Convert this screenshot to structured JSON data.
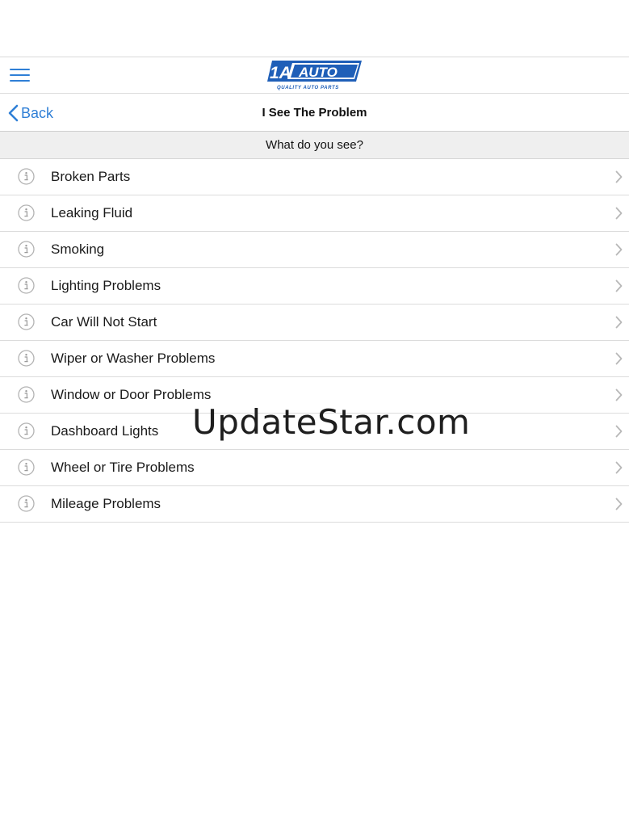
{
  "header": {
    "logo_main": "1A AUTO",
    "logo_tagline": "QUALITY AUTO PARTS",
    "menu_icon": "hamburger-menu-icon"
  },
  "navbar": {
    "back_label": "Back",
    "title": "I See The Problem"
  },
  "section": {
    "header": "What do you see?"
  },
  "items": [
    {
      "label": "Broken Parts"
    },
    {
      "label": "Leaking Fluid"
    },
    {
      "label": "Smoking"
    },
    {
      "label": "Lighting Problems"
    },
    {
      "label": "Car Will Not Start"
    },
    {
      "label": "Wiper or Washer Problems"
    },
    {
      "label": "Window or Door Problems"
    },
    {
      "label": "Dashboard Lights"
    },
    {
      "label": "Wheel or Tire Problems"
    },
    {
      "label": "Mileage Problems"
    }
  ],
  "watermark": "UpdateStar.com",
  "colors": {
    "accent": "#2f7fd6",
    "logo_blue": "#1f5fb8",
    "separator": "#dcdcdc",
    "section_bg": "#efefef"
  }
}
